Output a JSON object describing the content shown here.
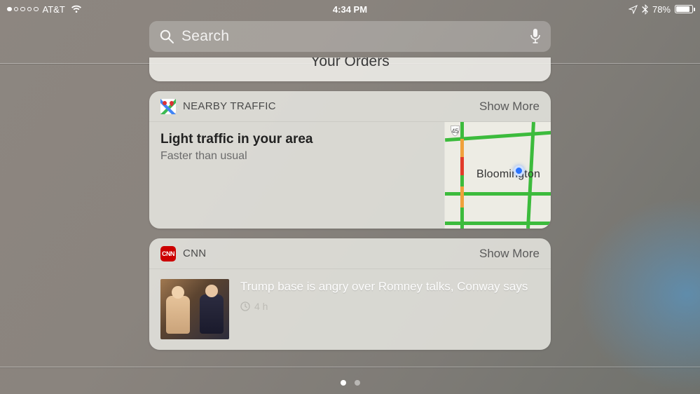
{
  "status": {
    "carrier": "AT&T",
    "time": "4:34 PM",
    "battery_pct": "78%"
  },
  "search": {
    "placeholder": "Search"
  },
  "widgets": {
    "orders_peek_title": "Your Orders",
    "traffic": {
      "header": "NEARBY TRAFFIC",
      "show_more": "Show More",
      "headline": "Light traffic in your area",
      "subline": "Faster than usual",
      "map_city": "Bloomington",
      "map_route_label": "45"
    },
    "cnn": {
      "header": "CNN",
      "badge": "CNN",
      "show_more": "Show More",
      "headline": "Trump base is angry over Romney talks, Conway says",
      "age": "4 h"
    }
  }
}
